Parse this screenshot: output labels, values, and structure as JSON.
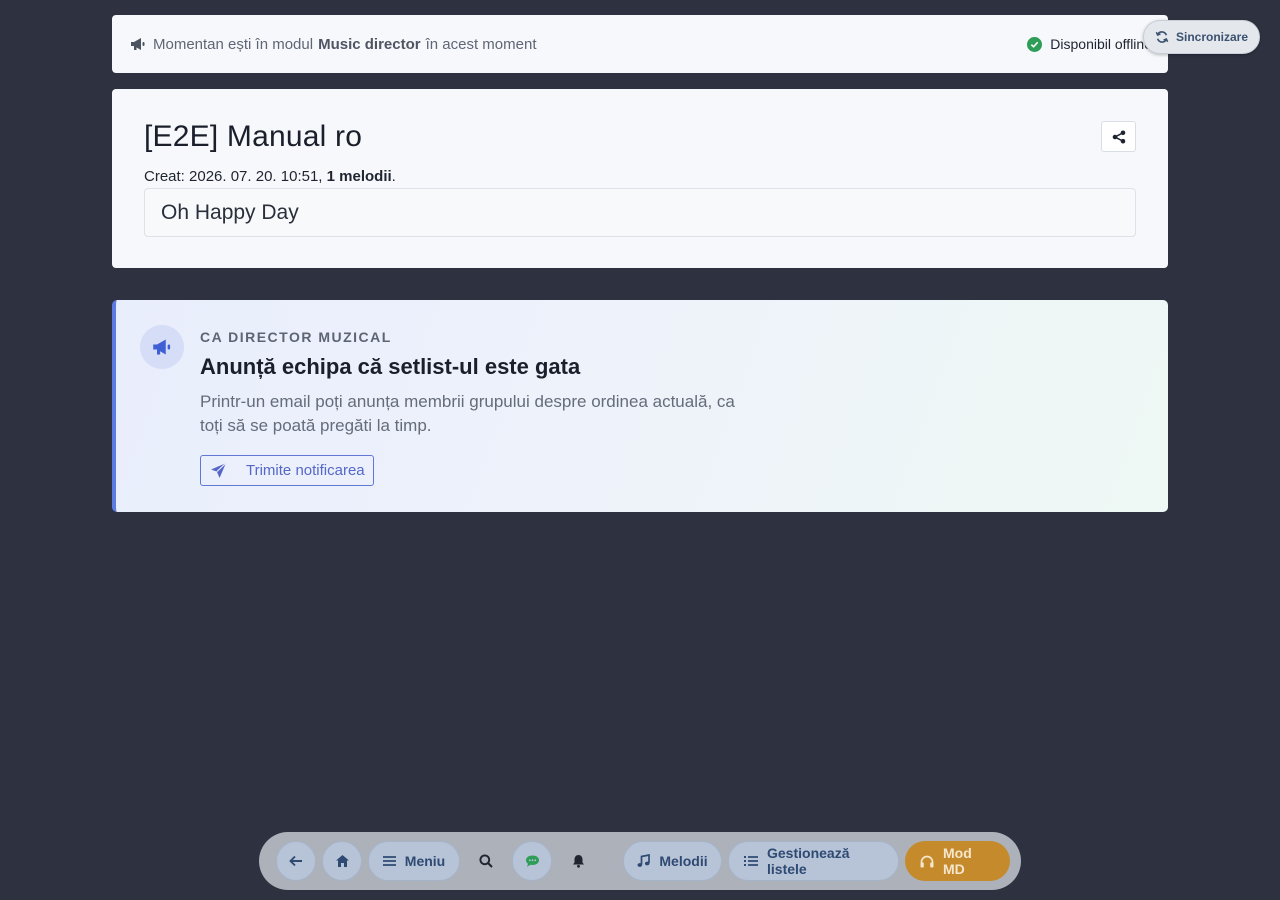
{
  "mode_banner": {
    "prefix": "Momentan ești în modul",
    "mode": "Music director",
    "suffix": "în acest moment",
    "offline_status": "Disponibil offline"
  },
  "sync_button": {
    "label": "Sincronizare"
  },
  "setlist": {
    "title": "[E2E] Manual ro",
    "created_prefix": "Creat: 2026. 07. 20. 10:51,",
    "song_count": "1 melodii",
    "created_suffix": ".",
    "songs": [
      "Oh Happy Day"
    ]
  },
  "announcement": {
    "kicker": "CA DIRECTOR MUZICAL",
    "title": "Anunță echipa că setlist-ul este gata",
    "description": "Printr-un email poți anunța membrii grupului despre ordinea actuală, ca toți să se poată pregăti la timp.",
    "button_label": "Trimite notificarea"
  },
  "toolbar": {
    "menu_label": "Meniu",
    "songs_label": "Melodii",
    "lists_label": "Gestionează listele",
    "md_label": "Mod MD"
  },
  "colors": {
    "background": "#2e3240",
    "accent": "#5b7be0",
    "success": "#2e9d57",
    "md_mode": "#c48a2c"
  },
  "icons": [
    "megaphone-icon",
    "check-circle-icon",
    "sync-icon",
    "share-icon",
    "paper-plane-icon",
    "arrow-left-icon",
    "home-icon",
    "menu-icon",
    "search-icon",
    "chat-icon",
    "bell-icon",
    "music-note-icon",
    "list-icon",
    "headphones-icon"
  ]
}
